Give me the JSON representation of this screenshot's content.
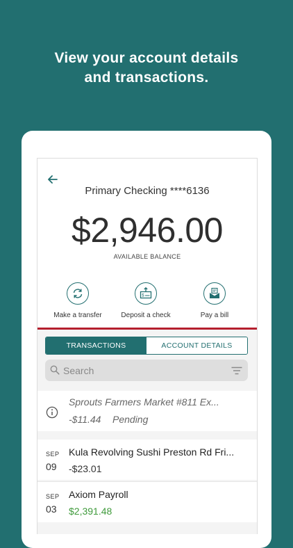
{
  "headline": {
    "line1": "View your account details",
    "line2": "and transactions."
  },
  "account": {
    "title": "Primary Checking ****6136",
    "balance": "$2,946.00",
    "balance_label": "AVAILABLE BALANCE"
  },
  "actions": [
    {
      "label": "Make a transfer",
      "icon": "transfer-icon"
    },
    {
      "label": "Deposit a check",
      "icon": "deposit-check-icon"
    },
    {
      "label": "Pay a bill",
      "icon": "pay-bill-icon"
    }
  ],
  "tabs": [
    {
      "label": "TRANSACTIONS",
      "active": true
    },
    {
      "label": "ACCOUNT DETAILS",
      "active": false
    }
  ],
  "search": {
    "placeholder": "Search"
  },
  "pending": {
    "merchant": "Sprouts Farmers Market #811 Ex...",
    "amount": "-$11.44",
    "status": "Pending"
  },
  "transactions": [
    {
      "month": "SEP",
      "day": "09",
      "merchant": "Kula Revolving Sushi Preston Rd Fri...",
      "amount": "-$23.01",
      "positive": false
    },
    {
      "month": "SEP",
      "day": "03",
      "merchant": "Axiom Payroll",
      "amount": "$2,391.48",
      "positive": true
    }
  ],
  "colors": {
    "background": "#226f70",
    "accent": "#226f70",
    "divider_red": "#b51f2e",
    "positive_amount": "#3f9a3b"
  }
}
